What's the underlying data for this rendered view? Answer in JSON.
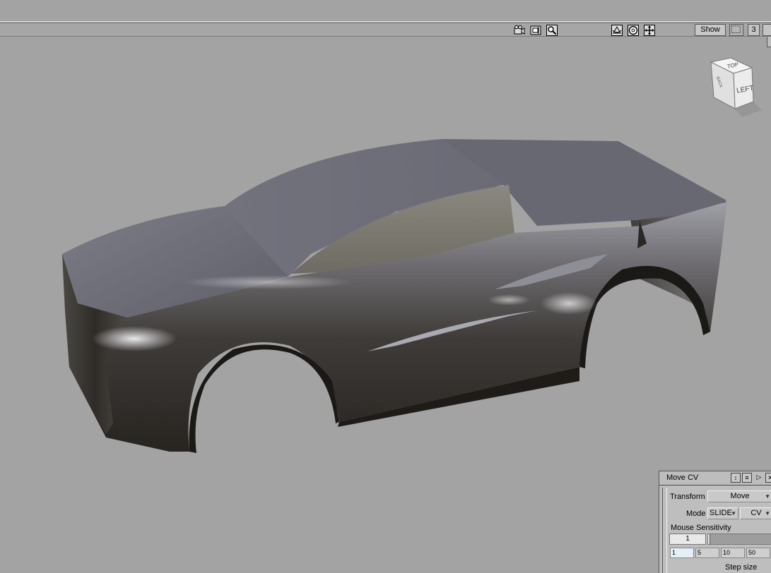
{
  "toolbar": {
    "icons": [
      "camera-icon",
      "film-icon",
      "zoom-icon",
      "tumble-icon",
      "dolly-icon",
      "pan-icon"
    ],
    "show_label": "Show",
    "layout_icon": "layout-icon",
    "count_label": "3"
  },
  "view_cube": {
    "top_label": "TOP",
    "left_label": "LEFT",
    "side_label": "BACK"
  },
  "panel": {
    "title": "Move CV",
    "transform_label": "Transform",
    "transform_value": "Move",
    "mode_label": "Mode",
    "mode_value": "SLIDE",
    "mode_target": "CV",
    "sensitivity_label": "Mouse Sensitivity",
    "sensitivity_value": "1",
    "steps": [
      "1",
      "5",
      "10",
      "50"
    ],
    "step_size_label": "Step size"
  },
  "colors": {
    "viewport_background": "#a3a3a3",
    "car_body_dark": "#2d2a26",
    "car_body_light": "#8a8a95"
  }
}
